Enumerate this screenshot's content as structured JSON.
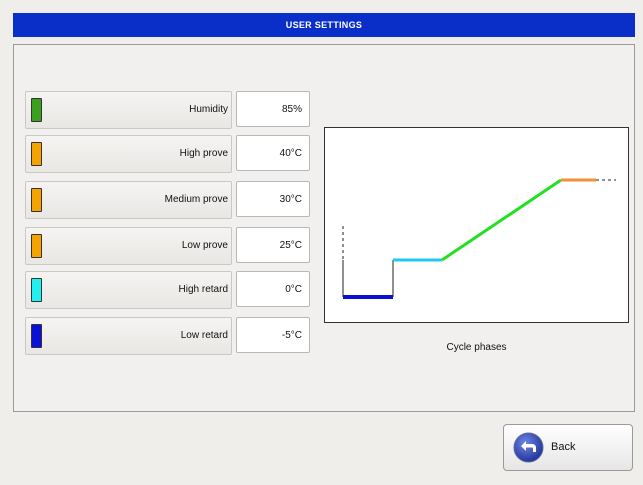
{
  "header": {
    "title": "USER SETTINGS"
  },
  "settings": [
    {
      "label": "Humidity",
      "value": "85%",
      "color": "#3aa01e"
    },
    {
      "label": "High prove",
      "value": "40°C",
      "color": "#f5a300"
    },
    {
      "label": "Medium prove",
      "value": "30°C",
      "color": "#f5a300"
    },
    {
      "label": "Low prove",
      "value": "25°C",
      "color": "#f5a300"
    },
    {
      "label": "High retard",
      "value": "0°C",
      "color": "#22f0f0"
    },
    {
      "label": "Low retard",
      "value": "-5°C",
      "color": "#0a10d8"
    }
  ],
  "diagram": {
    "caption": "Cycle phases",
    "colors": {
      "low_retard": "#0a10d8",
      "high_retard": "#22c8ee",
      "ramp": "#22e022",
      "prove": "#f2913a"
    }
  },
  "footer": {
    "back_label": "Back",
    "icon": "back-arrow-icon"
  }
}
